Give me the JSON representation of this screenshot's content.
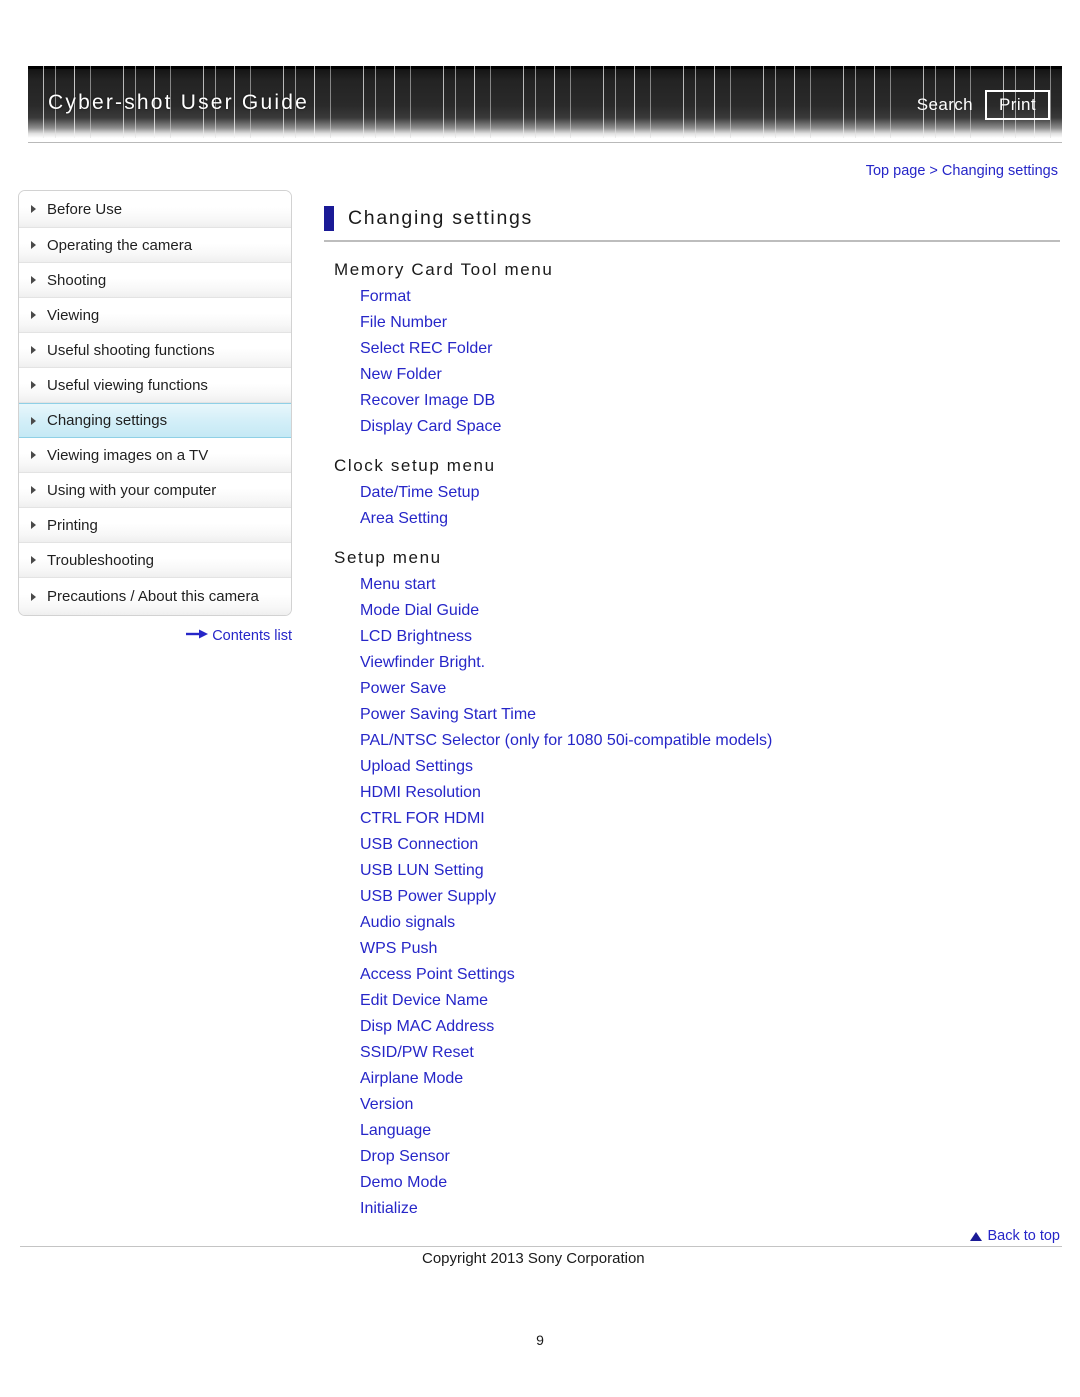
{
  "header": {
    "title": "Cyber-shot User Guide",
    "search_label": "Search",
    "print_label": "Print"
  },
  "breadcrumb": {
    "top": "Top page",
    "separator": ">",
    "current": "Changing settings"
  },
  "sidebar": {
    "items": [
      {
        "label": "Before Use",
        "active": false
      },
      {
        "label": "Operating the camera",
        "active": false
      },
      {
        "label": "Shooting",
        "active": false
      },
      {
        "label": "Viewing",
        "active": false
      },
      {
        "label": "Useful shooting functions",
        "active": false
      },
      {
        "label": "Useful viewing functions",
        "active": false
      },
      {
        "label": "Changing settings",
        "active": true
      },
      {
        "label": "Viewing images on a TV",
        "active": false
      },
      {
        "label": "Using with your computer",
        "active": false
      },
      {
        "label": "Printing",
        "active": false
      },
      {
        "label": "Troubleshooting",
        "active": false
      },
      {
        "label": "Precautions / About this camera",
        "active": false
      }
    ],
    "contents_list_label": "Contents list"
  },
  "main": {
    "page_title": "Changing settings",
    "sections": [
      {
        "heading": "Memory Card Tool menu",
        "links": [
          "Format",
          "File Number",
          "Select REC Folder",
          "New Folder",
          "Recover Image DB",
          "Display Card Space"
        ]
      },
      {
        "heading": "Clock setup menu",
        "links": [
          "Date/Time Setup",
          "Area Setting"
        ]
      },
      {
        "heading": "Setup menu",
        "links": [
          "Menu start",
          "Mode Dial Guide",
          "LCD Brightness",
          "Viewfinder Bright.",
          "Power Save",
          "Power Saving Start Time",
          "PAL/NTSC Selector (only for 1080 50i-compatible models)",
          "Upload Settings",
          "HDMI Resolution",
          "CTRL FOR HDMI",
          "USB Connection",
          "USB LUN Setting",
          "USB Power Supply",
          "Audio signals",
          "WPS Push",
          "Access Point Settings",
          "Edit Device Name",
          "Disp MAC Address",
          "SSID/PW Reset",
          "Airplane Mode",
          "Version",
          "Language",
          "Drop Sensor",
          "Demo Mode",
          "Initialize"
        ]
      }
    ]
  },
  "footer": {
    "back_to_top_label": "Back to top",
    "copyright": "Copyright 2013 Sony Corporation",
    "page_number": "9"
  },
  "colors": {
    "link": "#2626c8",
    "title_mark": "#1a1a96",
    "active_item": "#c5e9f5"
  }
}
